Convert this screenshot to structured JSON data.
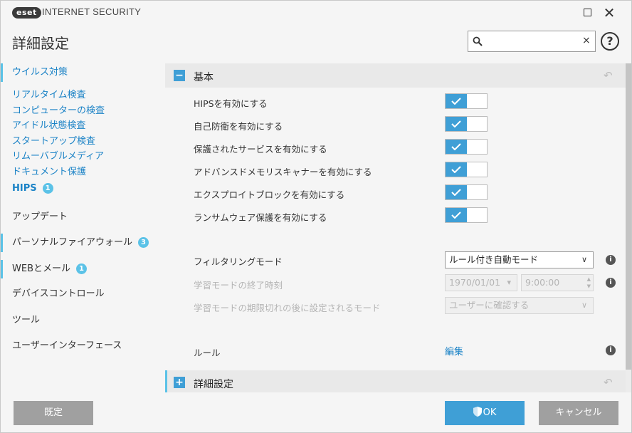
{
  "titlebar": {
    "logo": "eset",
    "app_title": "INTERNET SECURITY",
    "close_glyph": "✕"
  },
  "header": {
    "title": "詳細設定",
    "search_placeholder": "",
    "search_clear": "×",
    "help_glyph": "?"
  },
  "sidebar": {
    "antivirus": "ウイルス対策",
    "sub": {
      "realtime": "リアルタイム検査",
      "computer_scan": "コンピューターの検査",
      "idle_scan": "アイドル状態検査",
      "startup_scan": "スタートアップ検査",
      "removable": "リムーバブルメディア",
      "document": "ドキュメント保護",
      "hips": "HIPS",
      "hips_badge": "1"
    },
    "update": "アップデート",
    "firewall": "パーソナルファイアウォール",
    "firewall_badge": "3",
    "web_mail": "WEBとメール",
    "web_mail_badge": "1",
    "device_control": "デバイスコントロール",
    "tools": "ツール",
    "ui": "ユーザーインターフェース"
  },
  "basic": {
    "toggle_glyph": "−",
    "title": "基本",
    "rows": {
      "hips": "HIPSを有効にする",
      "self_defense": "自己防衛を有効にする",
      "protected_service": "保護されたサービスを有効にする",
      "advanced_memory": "アドバンスドメモリスキャナーを有効にする",
      "exploit_blocker": "エクスプロイトブロックを有効にする",
      "ransomware": "ランサムウェア保護を有効にする"
    },
    "filter_mode_label": "フィルタリングモード",
    "filter_mode_value": "ルール付き自動モード",
    "learn_end_label": "学習モードの終了時刻",
    "learn_end_date": "1970/01/01",
    "learn_end_time": "9:00:00",
    "after_learn_label": "学習モードの期限切れの後に設定されるモード",
    "after_learn_value": "ユーザーに確認する",
    "rules_label": "ルール",
    "rules_edit": "編集",
    "info_glyph": "i",
    "chev_glyph": "∨",
    "small_chev_glyph": "▾"
  },
  "advanced": {
    "toggle_glyph": "+",
    "title": "詳細設定"
  },
  "footer": {
    "default": "既定",
    "ok": "OK",
    "cancel": "キャンセル"
  },
  "colors": {
    "accent": "#5bc2e7",
    "primary": "#3f9fd6",
    "link": "#1a82c6",
    "button_gray": "#a0a0a0"
  }
}
